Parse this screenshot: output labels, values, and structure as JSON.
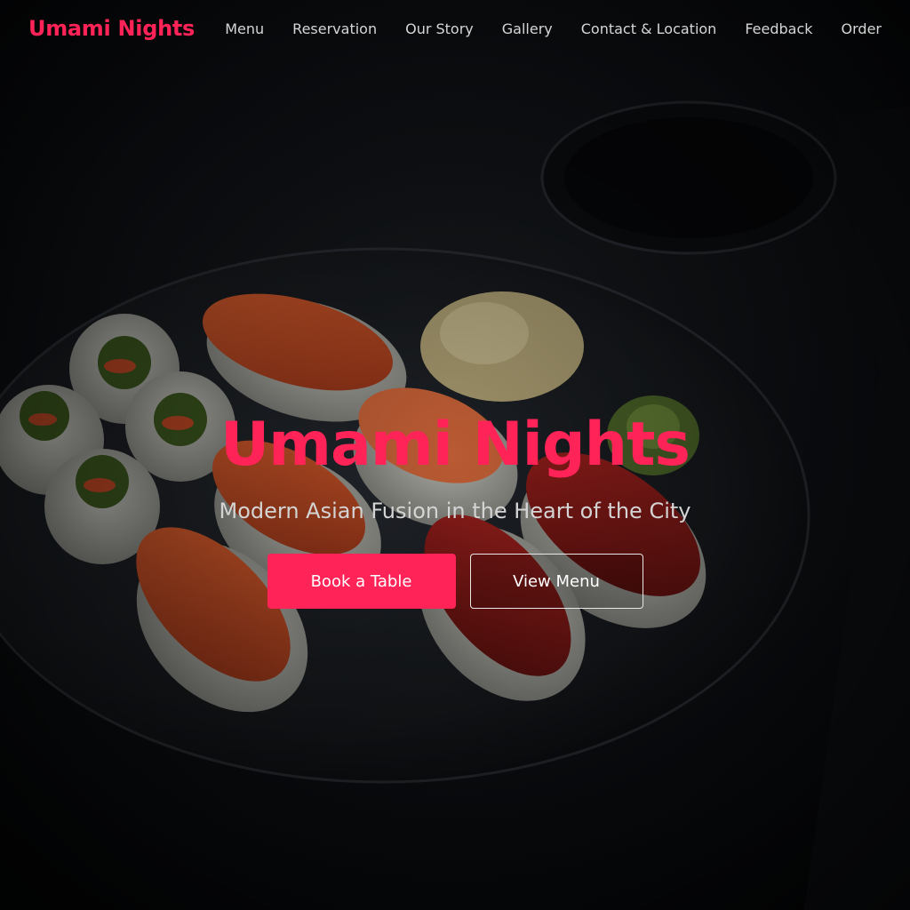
{
  "brand": {
    "name": "Umami Nights",
    "color": "#ff2358"
  },
  "nav": {
    "items": [
      {
        "label": "Menu"
      },
      {
        "label": "Reservation"
      },
      {
        "label": "Our Story"
      },
      {
        "label": "Gallery"
      },
      {
        "label": "Contact & Location"
      },
      {
        "label": "Feedback"
      },
      {
        "label": "Order"
      }
    ]
  },
  "hero": {
    "title": "Umami Nights",
    "subtitle": "Modern Asian Fusion in the Heart of the City",
    "primary_button": "Book a Table",
    "secondary_button": "View Menu"
  },
  "colors": {
    "accent": "#ff2358",
    "background": "#07090c",
    "text_muted": "#d4d4d4"
  }
}
